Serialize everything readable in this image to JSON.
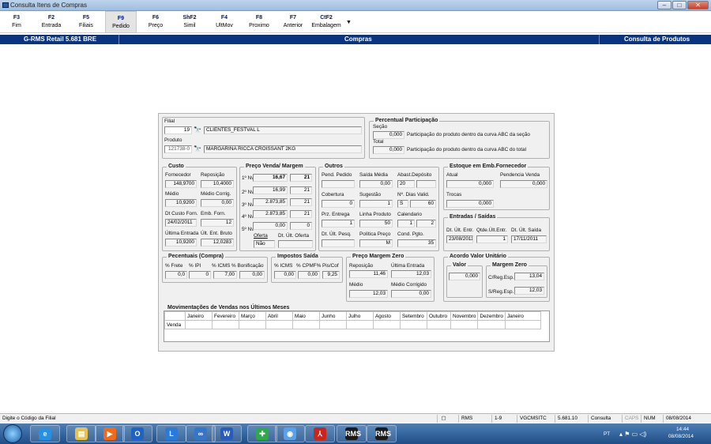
{
  "window": {
    "title": "Consulta Itens de Compras"
  },
  "toolbar": [
    {
      "key": "F3",
      "label": "Fim"
    },
    {
      "key": "F2",
      "label": "Entrada"
    },
    {
      "key": "F5",
      "label": "Filiais"
    },
    {
      "key": "F9",
      "label": "Pedido"
    },
    {
      "key": "F6",
      "label": "Preço"
    },
    {
      "key": "ShF2",
      "label": "Simil"
    },
    {
      "key": "F4",
      "label": "UltMov"
    },
    {
      "key": "F8",
      "label": "Proximo"
    },
    {
      "key": "F7",
      "label": "Anterior"
    },
    {
      "key": "CtF2",
      "label": "Embalagem"
    }
  ],
  "header": {
    "left": "G-RMS Retail 5.681 BRE",
    "center": "Compras",
    "right": "Consulta de Produtos"
  },
  "filial": {
    "label": "Filial",
    "code": "19",
    "name": "CLIENTES_FESTVAL L"
  },
  "produto": {
    "label": "Produto",
    "code": "121738-0",
    "name": "MARGARINA RICCA CROISSANT 2KG"
  },
  "percentual": {
    "title": "Percentual Participação",
    "secao_label": "Seção",
    "secao_value": "0,000",
    "secao_desc": "Participação do produto dentro da curva ABC da seção",
    "total_label": "Total",
    "total_value": "0,000",
    "total_desc": "Participação do produto dentro da curva ABC do total"
  },
  "custo": {
    "title": "Custo",
    "fornecedor_label": "Fornecedor",
    "fornecedor": "148,9700",
    "reposicao_label": "Reposição",
    "reposicao": "10,4000",
    "medio_label": "Médio",
    "medio": "10,9200",
    "medio_corrig_label": "Médio Corrig.",
    "medio_corrig": "0,00",
    "dt_custo_label": "Dt Custo Forn.",
    "dt_custo": "24/02/2011",
    "emb_forn_label": "Emb. Forn.",
    "emb_forn": "12",
    "ult_entrada_label": "Última Entrada",
    "ult_entrada": "10,9200",
    "ult_ent_bruto_label": "Últ. Ent. Bruto",
    "ult_ent_bruto": "12,0283"
  },
  "preco_venda": {
    "title": "Preço Venda/ Margem",
    "rows": [
      {
        "label": "1º Nv",
        "preco": "16,67",
        "margem": "21"
      },
      {
        "label": "2º Nv",
        "preco": "16,99",
        "margem": "21"
      },
      {
        "label": "3º Nv",
        "preco": "2.873,85",
        "margem": "21"
      },
      {
        "label": "4º Nv",
        "preco": "2.873,85",
        "margem": "21"
      },
      {
        "label": "5º Nv",
        "preco": "0,00",
        "margem": "0"
      }
    ],
    "oferta_label": "Oferta",
    "oferta": "Não",
    "dt_ult_oferta_label": "Dt. Últ. Oferta",
    "dt_ult_oferta": ""
  },
  "outros": {
    "title": "Outros",
    "pend_pedido_label": "Pend. Pedido",
    "pend_pedido": "",
    "saida_media_label": "Saída Média",
    "saida_media": "0,00",
    "abast_deposito_label": "Abast.Depósito",
    "abast_deposito": "20",
    "cobertura_label": "Cobertura",
    "cobertura": "0",
    "sugestao_label": "Sugestão",
    "sugestao": "1",
    "dias_valid_label": "Nº. Dias Valid.",
    "dias_valid_flag": "S",
    "dias_valid": "60",
    "prz_entrega_label": "Prz. Entrega",
    "prz_entrega": "1",
    "linha_produto_label": "Linha Produto",
    "linha_produto": "50",
    "calendario_label": "Calendario",
    "calendario_a": "1",
    "calendario_b": "2",
    "dt_ult_pesq_label": "Dt. Últ. Pesq.",
    "dt_ult_pesq": "",
    "politica_preco_label": "Política Preço",
    "politica_preco": "M",
    "cond_pgto_label": "Cond. Pgto.",
    "cond_pgto": "35"
  },
  "estoque": {
    "title": "Estoque em Emb.Fornecedor",
    "atual_label": "Atual",
    "atual": "0,000",
    "pendencia_label": "Pendencia Venda",
    "pendencia": "0,000",
    "trocas_label": "Trocas",
    "trocas": "0,000"
  },
  "entradas_saidas": {
    "title": "Entradas / Saídas",
    "dt_ult_entr_label": "Dt. Últ. Entr.",
    "dt_ult_entr": "23/08/2011",
    "qtde_ult_entr_label": "Qtde.Últ.Entr.",
    "qtde_ult_entr": "1",
    "dt_ult_saida_label": "Dt. Últ. Saída",
    "dt_ult_saida": "17/11/2011"
  },
  "percentuais": {
    "title": "Pecentuais (Compra)",
    "frete_label": "% Frete",
    "frete": "0,0",
    "ipi_label": "% IPI",
    "ipi": "0",
    "icms_label": "% ICMS",
    "icms": "7,00",
    "bonif_label": "% Bonificação",
    "bonif": "0,00"
  },
  "impostos": {
    "title": "Impostos Saída",
    "icms_label": "% ICMS",
    "icms": "0,00",
    "cpmf_label": "% CPMF%",
    "cpmf": "0,00",
    "piscof_label": "Pis/Cof",
    "piscof": "9,25"
  },
  "preco_margem_zero": {
    "title": "Preço Margem Zero",
    "reposicao_label": "Reposição",
    "reposicao": "11,46",
    "ultima_entrada_label": "Última Entrada",
    "ultima_entrada": "12,03",
    "medio_label": "Médio",
    "medio": "12,03",
    "medio_corrigido_label": "Médio Corrigido",
    "medio_corrigido": "0,00"
  },
  "acordo": {
    "title": "Acordo Valor Unitário",
    "valor_label": "Valor",
    "valor": "0,000",
    "margem_zero_label": "Margem Zero",
    "creg_label": "C/Reg.Esp.",
    "creg": "13,04",
    "sreg_label": "S/Reg.Esp.",
    "sreg": "12,03"
  },
  "movimentacoes": {
    "title": "Movimentações de Vendas nos Últimos Meses",
    "months": [
      "Janeiro",
      "Fevereiro",
      "Março",
      "Abril",
      "Maio",
      "Junho",
      "Julho",
      "Agosto",
      "Setembro",
      "Outubro",
      "Novembro",
      "Dezembro",
      "Janeiro"
    ],
    "row_label": "Venda"
  },
  "status": {
    "message": "Digite o Código da Filial",
    "rms": "RMS",
    "pages": "1-9",
    "user": "VGCMSITC",
    "version": "5.681.10",
    "mode": "Consulta",
    "caps": "CAPS",
    "num": "NUM",
    "date": "08/08/2014"
  },
  "taskbar": {
    "lang": "PT",
    "time": "14:44",
    "date": "08/08/2014",
    "apps": [
      {
        "name": "ie-icon",
        "glyph": "e",
        "color": "#2b8fe0"
      },
      {
        "name": "explorer-icon",
        "glyph": "▤",
        "color": "#e8c24a"
      },
      {
        "name": "media-icon",
        "glyph": "▶",
        "color": "#f06a1a"
      },
      {
        "name": "outlook-icon",
        "glyph": "O",
        "color": "#1f62c4"
      },
      {
        "name": "lync-icon",
        "glyph": "L",
        "color": "#2a7ad8"
      },
      {
        "name": "link-icon",
        "glyph": "∞",
        "color": "#3576c8"
      },
      {
        "name": "word-icon",
        "glyph": "W",
        "color": "#2b5bb8"
      },
      {
        "name": "install-icon",
        "glyph": "✚",
        "color": "#2fa84a"
      },
      {
        "name": "disc-icon",
        "glyph": "◉",
        "color": "#5aa0e8"
      },
      {
        "name": "pdf-icon",
        "glyph": "⅄",
        "color": "#c8261c"
      },
      {
        "name": "rms-icon",
        "glyph": "RMS",
        "color": "#1a1a1a"
      },
      {
        "name": "rms-icon-2",
        "glyph": "RMS",
        "color": "#1a1a1a"
      }
    ]
  }
}
